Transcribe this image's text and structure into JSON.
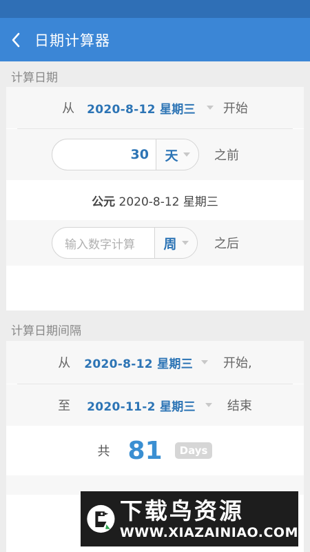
{
  "header": {
    "title": "日期计算器"
  },
  "section1": {
    "label": "计算日期",
    "from_label": "从",
    "from_date": "2020-8-12 星期三",
    "start_label": "开始",
    "offset_value": "30",
    "offset_unit": "天",
    "before_label": "之前",
    "result_prefix": "公元",
    "result_date": "2020-8-12 星期三",
    "after_placeholder": "输入数字计算",
    "after_unit": "周",
    "after_label": "之后"
  },
  "section2": {
    "label": "计算日期间隔",
    "from_label": "从",
    "from_date": "2020-8-12 星期三",
    "start_label": "开始,",
    "to_label": "至",
    "to_date": "2020-11-2 星期三",
    "end_label": "结束",
    "total_label": "共",
    "total_value": "81",
    "total_unit": "Days"
  },
  "watermark": {
    "title": "下载鸟资源",
    "url": "WWW.XIAZAINIAO.COM"
  }
}
